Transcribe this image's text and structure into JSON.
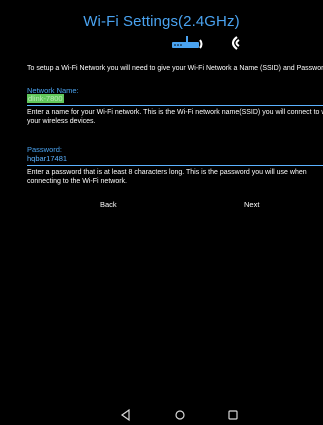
{
  "header": {
    "title": "Wi-Fi Settings(2.4GHz)"
  },
  "icons": {
    "router": "router-icon",
    "signal": "wifi-signal-icon"
  },
  "intro": {
    "text": "To setup a Wi-Fi Network you will need to give your Wi-Fi Network a Name (SSID) and Password"
  },
  "network_name": {
    "label": "Network Name:",
    "value": "dlink-7800",
    "help": "Enter a name for your Wi-Fi network. This is the Wi-Fi network name(SSID) you will connect to with your wireless devices."
  },
  "password": {
    "label": "Password:",
    "value": "hqbar17481",
    "help": "Enter a password that is at least 8 characters long. This is the password you will use when connecting to the Wi-Fi network."
  },
  "buttons": {
    "back": "Back",
    "next": "Next"
  },
  "navbar": {
    "back_icon": "back-triangle-icon",
    "home_icon": "home-circle-icon",
    "recent_icon": "recent-apps-icon"
  },
  "colors": {
    "accent": "#4aa3f0",
    "highlight": "#61c85c",
    "background": "#000000"
  }
}
